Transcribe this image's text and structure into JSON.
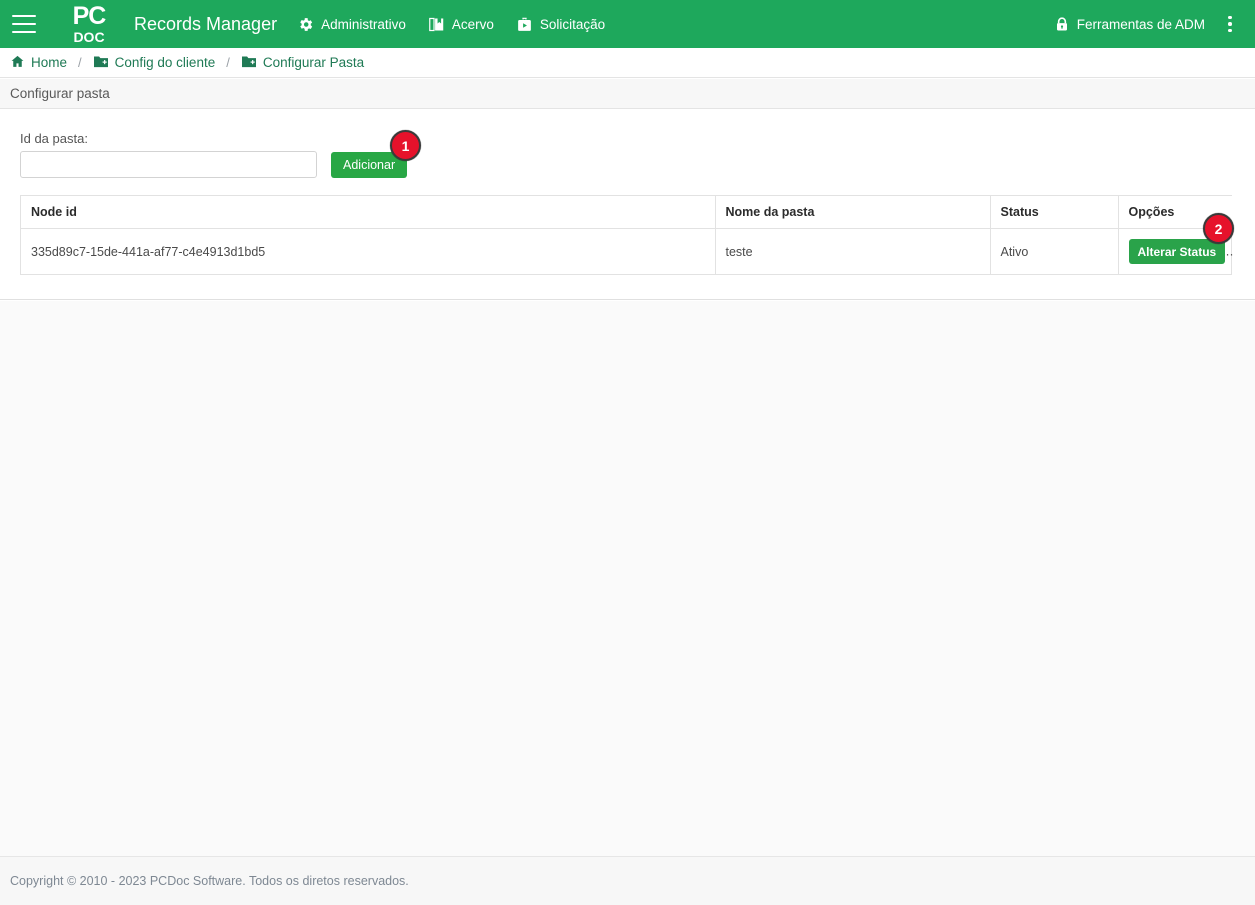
{
  "header": {
    "menu_icon": "hamburger-menu-icon",
    "logo_top": "PC",
    "logo_bottom": "DOC",
    "brand_title": "Records Manager",
    "nav": [
      {
        "label": "Administrativo",
        "icon": "gear-icon"
      },
      {
        "label": "Acervo",
        "icon": "book-icon"
      },
      {
        "label": "Solicitação",
        "icon": "briefcase-play-icon"
      }
    ],
    "admin_tools": {
      "label": "Ferramentas de ADM",
      "icon": "lock-icon"
    },
    "overflow_icon": "kebab-menu-icon",
    "background_color": "#1ea85c"
  },
  "breadcrumb": {
    "separator": "/",
    "items": [
      {
        "label": "Home",
        "icon": "home-icon"
      },
      {
        "label": "Config do cliente",
        "icon": "folder-plus-icon"
      },
      {
        "label": "Configurar Pasta",
        "icon": "folder-plus-icon"
      }
    ],
    "link_color": "#1f7a55"
  },
  "page_title": "Configurar pasta",
  "form": {
    "id_label": "Id da pasta:",
    "id_value": "",
    "id_placeholder": "",
    "add_button": "Adicionar",
    "add_button_color": "#28a745"
  },
  "table": {
    "columns": [
      "Node id",
      "Nome da pasta",
      "Status",
      "Opções"
    ],
    "rows": [
      {
        "node_id": "335d89c7-15de-441a-af77-c4e4913d1bd5",
        "folder_name": "teste",
        "status": "Ativo",
        "action_label": "Alterar Status"
      }
    ],
    "action_button_color": "#2aa34a"
  },
  "annotations": [
    {
      "number": "1",
      "color": "#e6122b"
    },
    {
      "number": "2",
      "color": "#e6122b"
    }
  ],
  "footer": {
    "copyright": "Copyright © 2010 - 2023 PCDoc Software. Todos os diretos reservados."
  }
}
